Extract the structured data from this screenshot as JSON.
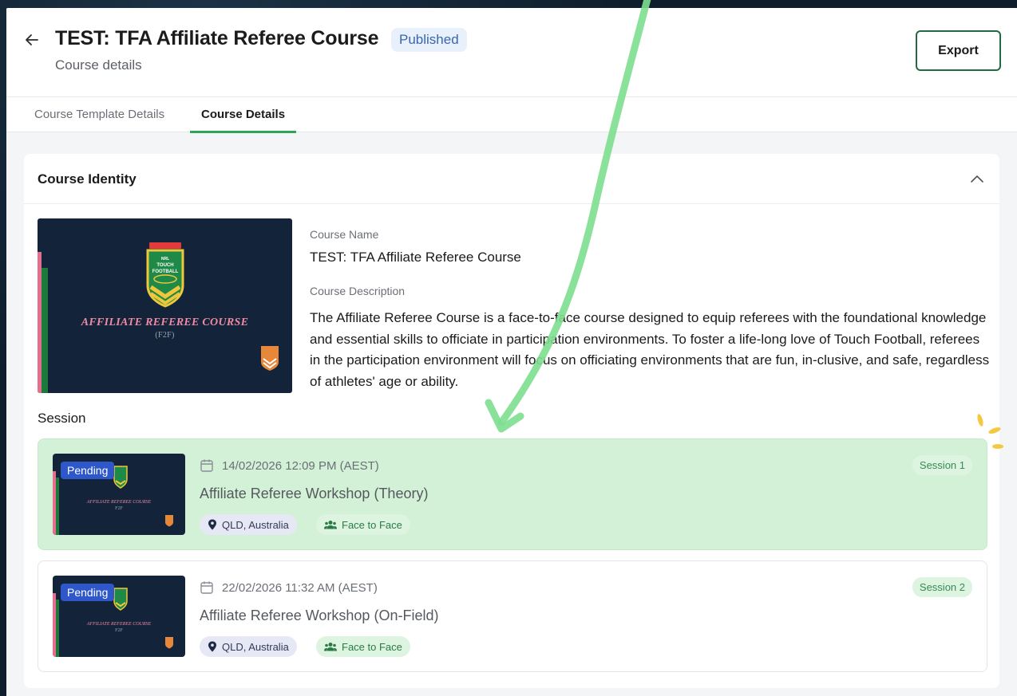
{
  "header": {
    "title": "TEST: TFA Affiliate Referee Course",
    "status": "Published",
    "subtitle": "Course details",
    "export_label": "Export"
  },
  "tabs": [
    {
      "label": "Course Template Details",
      "active": false
    },
    {
      "label": "Course Details",
      "active": true
    }
  ],
  "course_identity": {
    "section_title": "Course Identity",
    "banner": {
      "brand_small": "NRL",
      "brand_line1": "TOUCH",
      "brand_line2": "FOOTBALL",
      "title": "AFFILIATE REFEREE COURSE",
      "subtitle": "(F2F)"
    },
    "course_name_label": "Course Name",
    "course_name": "TEST: TFA Affiliate Referee Course",
    "course_description_label": "Course Description",
    "course_description": "The Affiliate Referee Course is a face-to-face course designed to equip referees with the foundational knowledge and essential skills to officiate in participation environments. To foster a life-long love of Touch Football, referees in the participation environment will focus on officiating environments that are fun, in-clusive, and safe, regardless of athletes' age or ability."
  },
  "session_section_title": "Session",
  "sessions": [
    {
      "status": "Pending",
      "date": "14/02/2026 12:09 PM (AEST)",
      "title": "Affiliate Referee Workshop (Theory)",
      "location": "QLD, Australia",
      "mode": "Face to Face",
      "session_label": "Session 1",
      "thumb_title": "AFFILIATE REFEREE COURSE",
      "thumb_subtitle": "F2F"
    },
    {
      "status": "Pending",
      "date": "22/02/2026 11:32 AM (AEST)",
      "title": "Affiliate Referee Workshop (On-Field)",
      "location": "QLD, Australia",
      "mode": "Face to Face",
      "session_label": "Session 2",
      "thumb_title": "AFFILIATE REFEREE COURSE",
      "thumb_subtitle": "F2F"
    }
  ],
  "colors": {
    "accent_green": "#2fa55a",
    "export_border": "#1f6b43",
    "published_bg": "#e8f0fb",
    "pending_bg": "#2e57c9",
    "highlight_green": "#d3f1d6",
    "annotation_arrow": "#7ddf8f"
  },
  "icons": {
    "back": "arrow-left-icon",
    "collapse": "chevron-up-icon",
    "calendar": "calendar-icon",
    "location": "map-pin-icon",
    "mode": "people-icon"
  }
}
